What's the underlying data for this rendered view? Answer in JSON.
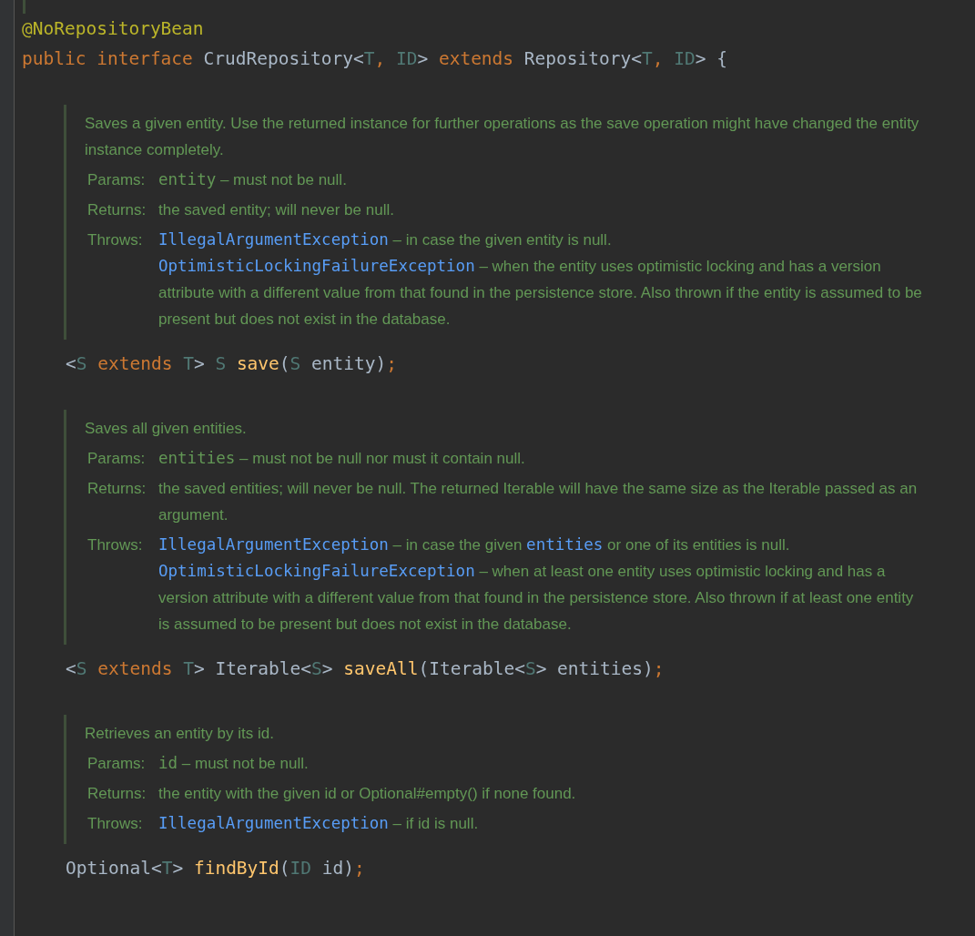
{
  "annotation": "@NoRepositoryBean",
  "declaration": [
    {
      "kind": "keyword",
      "text": "public interface "
    },
    {
      "kind": "plain",
      "text": "CrudRepository<"
    },
    {
      "kind": "type_param",
      "text": "T"
    },
    {
      "kind": "keyword",
      "text": ", "
    },
    {
      "kind": "type_param",
      "text": "ID"
    },
    {
      "kind": "plain",
      "text": "> "
    },
    {
      "kind": "keyword",
      "text": "extends "
    },
    {
      "kind": "plain",
      "text": "Repository<"
    },
    {
      "kind": "type_param",
      "text": "T"
    },
    {
      "kind": "keyword",
      "text": ", "
    },
    {
      "kind": "type_param",
      "text": "ID"
    },
    {
      "kind": "plain",
      "text": "> {"
    }
  ],
  "members": [
    {
      "doc": {
        "description": "Saves a given entity. Use the returned instance for further operations as the save operation might have changed the entity instance completely.",
        "tags": [
          {
            "label": "Params:",
            "entries": [
              [
                {
                  "kind": "code",
                  "text": "entity"
                },
                {
                  "kind": "text",
                  "text": " – must not be null."
                }
              ]
            ]
          },
          {
            "label": "Returns:",
            "entries": [
              [
                {
                  "kind": "text",
                  "text": "the saved entity; will never be null."
                }
              ]
            ]
          },
          {
            "label": "Throws:",
            "entries": [
              [
                {
                  "kind": "link",
                  "text": "IllegalArgumentException"
                },
                {
                  "kind": "text",
                  "text": " – in case the given entity is null."
                }
              ],
              [
                {
                  "kind": "link",
                  "text": "OptimisticLockingFailureException"
                },
                {
                  "kind": "text",
                  "text": " – when the entity uses optimistic locking and has a version attribute with a different value from that found in the persistence store. Also thrown if the entity is assumed to be present but does not exist in the database."
                }
              ]
            ]
          }
        ]
      },
      "signature": [
        {
          "kind": "plain",
          "text": "<"
        },
        {
          "kind": "type_param",
          "text": "S "
        },
        {
          "kind": "keyword",
          "text": "extends "
        },
        {
          "kind": "type_param",
          "text": "T"
        },
        {
          "kind": "plain",
          "text": "> "
        },
        {
          "kind": "type_param",
          "text": "S "
        },
        {
          "kind": "method",
          "text": "save"
        },
        {
          "kind": "plain",
          "text": "("
        },
        {
          "kind": "type_param",
          "text": "S "
        },
        {
          "kind": "plain",
          "text": "entity)"
        },
        {
          "kind": "keyword",
          "text": ";"
        }
      ]
    },
    {
      "doc": {
        "description": "Saves all given entities.",
        "tags": [
          {
            "label": "Params:",
            "entries": [
              [
                {
                  "kind": "code",
                  "text": "entities"
                },
                {
                  "kind": "text",
                  "text": " – must not be null nor must it contain null."
                }
              ]
            ]
          },
          {
            "label": "Returns:",
            "entries": [
              [
                {
                  "kind": "text",
                  "text": "the saved entities; will never be null. The returned Iterable will have the same size as the Iterable passed as an argument."
                }
              ]
            ]
          },
          {
            "label": "Throws:",
            "entries": [
              [
                {
                  "kind": "link",
                  "text": "IllegalArgumentException"
                },
                {
                  "kind": "text",
                  "text": " – in case the given "
                },
                {
                  "kind": "link",
                  "text": "entities"
                },
                {
                  "kind": "text",
                  "text": " or one of its entities is null."
                }
              ],
              [
                {
                  "kind": "link",
                  "text": "OptimisticLockingFailureException"
                },
                {
                  "kind": "text",
                  "text": " – when at least one entity uses optimistic locking and has a version attribute with a different value from that found in the persistence store. Also thrown if at least one entity is assumed to be present but does not exist in the database."
                }
              ]
            ]
          }
        ]
      },
      "signature": [
        {
          "kind": "plain",
          "text": "<"
        },
        {
          "kind": "type_param",
          "text": "S "
        },
        {
          "kind": "keyword",
          "text": "extends "
        },
        {
          "kind": "type_param",
          "text": "T"
        },
        {
          "kind": "plain",
          "text": "> Iterable<"
        },
        {
          "kind": "type_param",
          "text": "S"
        },
        {
          "kind": "plain",
          "text": "> "
        },
        {
          "kind": "method",
          "text": "saveAll"
        },
        {
          "kind": "plain",
          "text": "(Iterable<"
        },
        {
          "kind": "type_param",
          "text": "S"
        },
        {
          "kind": "plain",
          "text": "> entities)"
        },
        {
          "kind": "keyword",
          "text": ";"
        }
      ]
    },
    {
      "doc": {
        "description": "Retrieves an entity by its id.",
        "tags": [
          {
            "label": "Params:",
            "entries": [
              [
                {
                  "kind": "code",
                  "text": "id"
                },
                {
                  "kind": "text",
                  "text": " – must not be null."
                }
              ]
            ]
          },
          {
            "label": "Returns:",
            "entries": [
              [
                {
                  "kind": "text",
                  "text": "the entity with the given id or Optional#empty() if none found."
                }
              ]
            ]
          },
          {
            "label": "Throws:",
            "entries": [
              [
                {
                  "kind": "link",
                  "text": "IllegalArgumentException"
                },
                {
                  "kind": "text",
                  "text": " – if id is null."
                }
              ]
            ]
          }
        ]
      },
      "signature": [
        {
          "kind": "plain",
          "text": "Optional<"
        },
        {
          "kind": "type_param",
          "text": "T"
        },
        {
          "kind": "plain",
          "text": "> "
        },
        {
          "kind": "method",
          "text": "findById"
        },
        {
          "kind": "plain",
          "text": "("
        },
        {
          "kind": "type_param",
          "text": "ID "
        },
        {
          "kind": "plain",
          "text": "id)"
        },
        {
          "kind": "keyword",
          "text": ";"
        }
      ]
    }
  ]
}
